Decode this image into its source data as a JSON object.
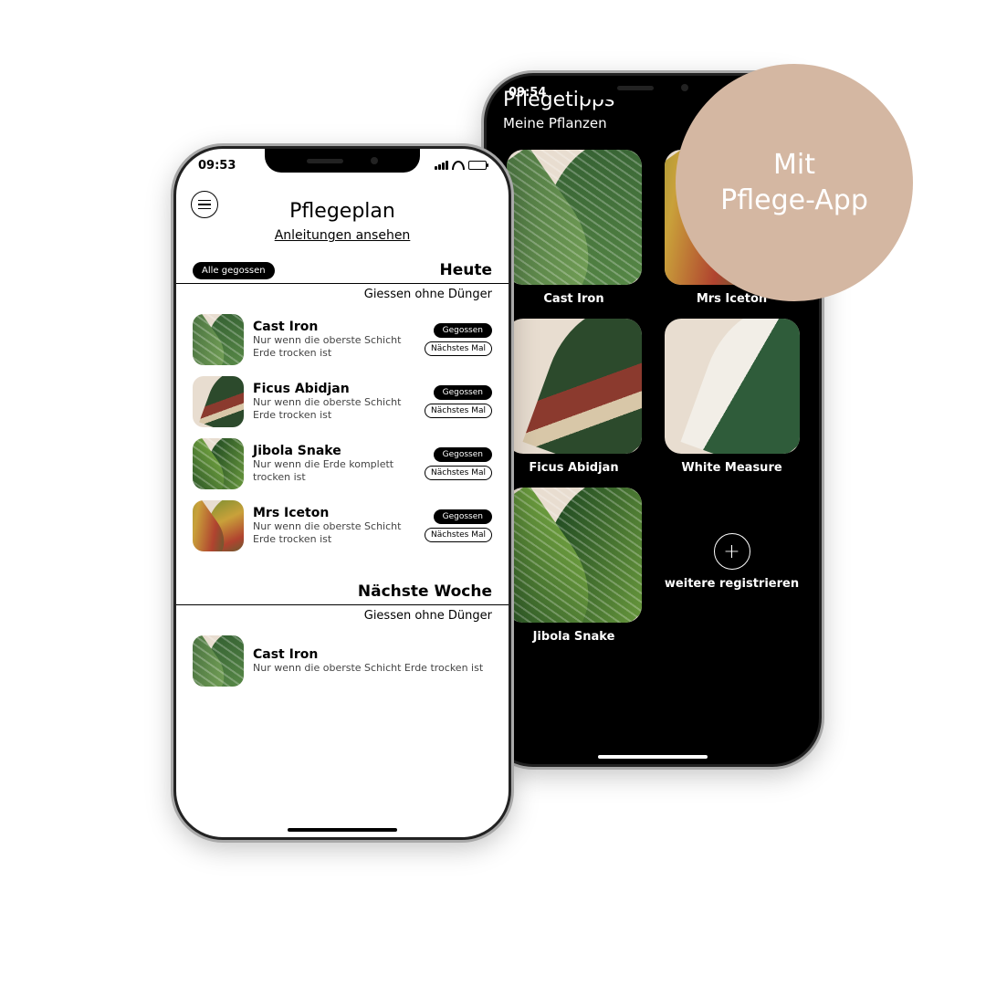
{
  "badge": {
    "line1": "Mit",
    "line2": "Pflege-App"
  },
  "phone_front": {
    "time": "09:53",
    "title": "Pflegeplan",
    "link": "Anleitungen ansehen",
    "all_done": "Alle gegossen",
    "sections": [
      {
        "title": "Heute",
        "subtitle": "Giessen ohne Dünger",
        "plants": [
          {
            "name": "Cast Iron",
            "desc": "Nur wenn die oberste Schicht Erde trocken ist",
            "done": "Gegossen",
            "skip": "Nächstes Mal"
          },
          {
            "name": "Ficus Abidjan",
            "desc": "Nur wenn die oberste Schicht Erde trocken ist",
            "done": "Gegossen",
            "skip": "Nächstes Mal"
          },
          {
            "name": "Jibola Snake",
            "desc": "Nur wenn die Erde komplett trocken ist",
            "done": "Gegossen",
            "skip": "Nächstes Mal"
          },
          {
            "name": "Mrs Iceton",
            "desc": "Nur wenn die oberste Schicht Erde trocken ist",
            "done": "Gegossen",
            "skip": "Nächstes Mal"
          }
        ]
      },
      {
        "title": "Nächste Woche",
        "subtitle": "Giessen ohne Dünger",
        "plants": [
          {
            "name": "Cast Iron",
            "desc": "Nur wenn die oberste Schicht Erde trocken ist"
          }
        ]
      }
    ]
  },
  "phone_back": {
    "time": "09:54",
    "title": "Pflegetipps",
    "subtitle": "Meine Pflanzen",
    "cells": [
      {
        "label": "Cast Iron"
      },
      {
        "label": "Mrs Iceton"
      },
      {
        "label": "Ficus Abidjan"
      },
      {
        "label": "White Measure"
      },
      {
        "label": "Jibola Snake"
      },
      {
        "label": "weitere registrieren",
        "is_add": true
      }
    ]
  }
}
